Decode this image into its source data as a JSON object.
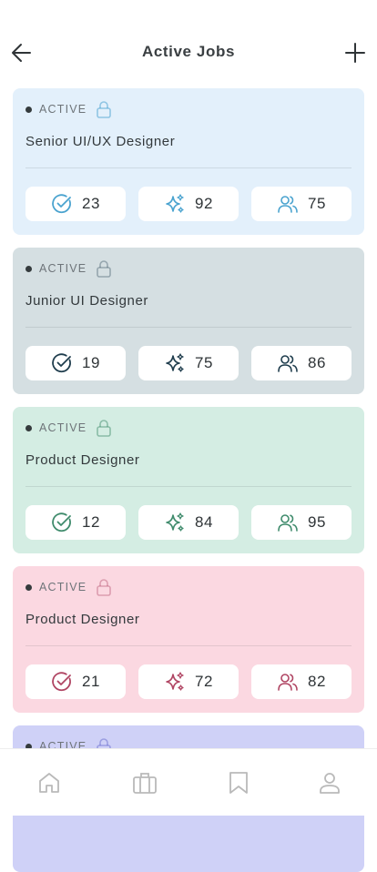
{
  "header": {
    "title": "Active Jobs",
    "back_icon": "arrow-left-icon",
    "add_icon": "plus-icon"
  },
  "jobs": [
    {
      "status": "ACTIVE",
      "title": "Senior UI/UX Designer",
      "bg": "#e3f0fb",
      "accent": "#4aa3cf",
      "stats": {
        "completed": "23",
        "featured": "92",
        "applicants": "75"
      }
    },
    {
      "status": "ACTIVE",
      "title": "Junior UI Designer",
      "bg": "#d5dfe2",
      "accent": "#1f3d4d",
      "stats": {
        "completed": "19",
        "featured": "75",
        "applicants": "86"
      }
    },
    {
      "status": "ACTIVE",
      "title": "Product Designer",
      "bg": "#d4ede3",
      "accent": "#3f8b6c",
      "stats": {
        "completed": "12",
        "featured": "84",
        "applicants": "95"
      }
    },
    {
      "status": "ACTIVE",
      "title": "Product Designer",
      "bg": "#fbd8e1",
      "accent": "#b04563",
      "stats": {
        "completed": "21",
        "featured": "72",
        "applicants": "82"
      }
    },
    {
      "status": "ACTIVE",
      "title": "",
      "bg": "#cfd1f7",
      "accent": "#5b5fc7",
      "stats": {
        "completed": "",
        "featured": "",
        "applicants": ""
      }
    }
  ],
  "bottom_nav": {
    "items": [
      "home-icon",
      "briefcase-icon",
      "bookmark-icon",
      "profile-icon"
    ]
  }
}
